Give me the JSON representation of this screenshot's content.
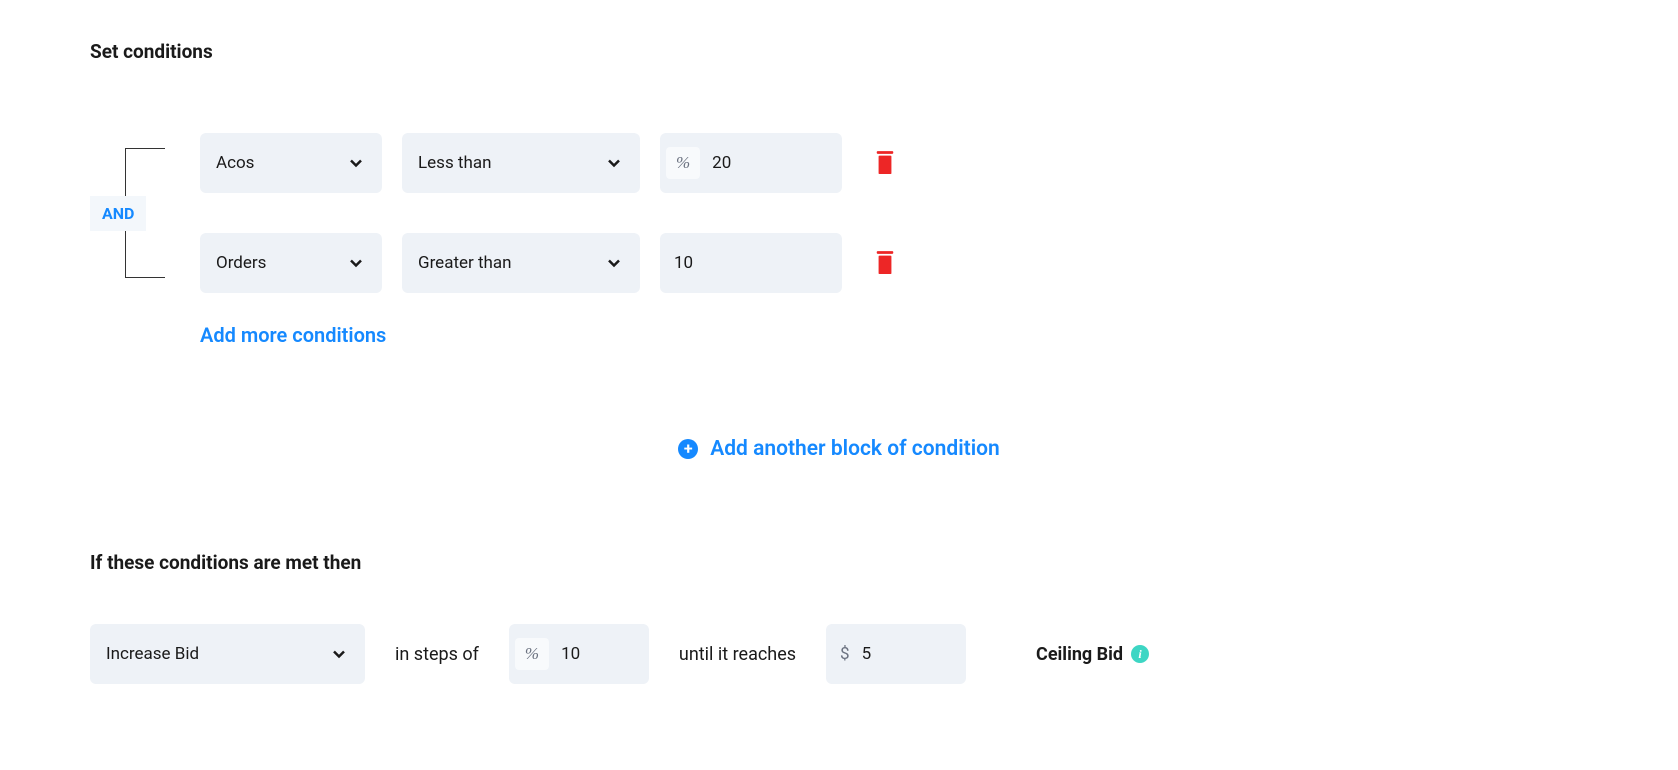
{
  "section_title": "Set conditions",
  "logic_operator": "AND",
  "conditions": [
    {
      "metric": "Acos",
      "operator": "Less than",
      "prefix": "%",
      "value": "20"
    },
    {
      "metric": "Orders",
      "operator": "Greater than",
      "prefix": "",
      "value": "10"
    }
  ],
  "add_more_label": "Add more conditions",
  "add_block_label": "Add another block of condition",
  "action_section_title": "If these conditions are met then",
  "action": {
    "type": "Increase Bid",
    "steps_label": "in steps of",
    "steps_prefix": "%",
    "steps_value": "10",
    "until_label": "until it reaches",
    "until_prefix": "$",
    "until_value": "5"
  },
  "ceiling_label": "Ceiling Bid"
}
